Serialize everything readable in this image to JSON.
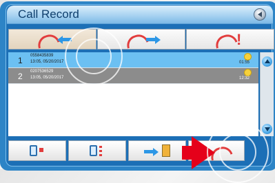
{
  "window": {
    "title": "Call Record"
  },
  "tabs": [
    {
      "name": "tab-received-calls",
      "icon": "phone-incoming-icon"
    },
    {
      "name": "tab-dialed-calls",
      "icon": "phone-outgoing-icon"
    },
    {
      "name": "tab-missed-calls",
      "icon": "phone-missed-icon"
    }
  ],
  "records": [
    {
      "index": "1",
      "number": "0558435839",
      "datetime": "13:05, 05/20/2017",
      "duration": "01:55",
      "state": "selected"
    },
    {
      "index": "2",
      "number": "0207536529",
      "datetime": "13:05, 05/20/2017",
      "duration": "12:32",
      "state": "normal"
    }
  ],
  "toolbar": {
    "buttons": [
      {
        "name": "delete-record-button",
        "icon": "delete-one-icon"
      },
      {
        "name": "delete-all-button",
        "icon": "delete-all-icon"
      },
      {
        "name": "save-to-contacts-button",
        "icon": "save-contact-icon"
      },
      {
        "name": "call-button",
        "icon": "phone-call-icon"
      }
    ]
  },
  "colors": {
    "accent": "#2d84c6",
    "selected_row": "#6cc0f2",
    "call_icon": "#e23d3d",
    "highlight_arrow": "#e5001a"
  }
}
